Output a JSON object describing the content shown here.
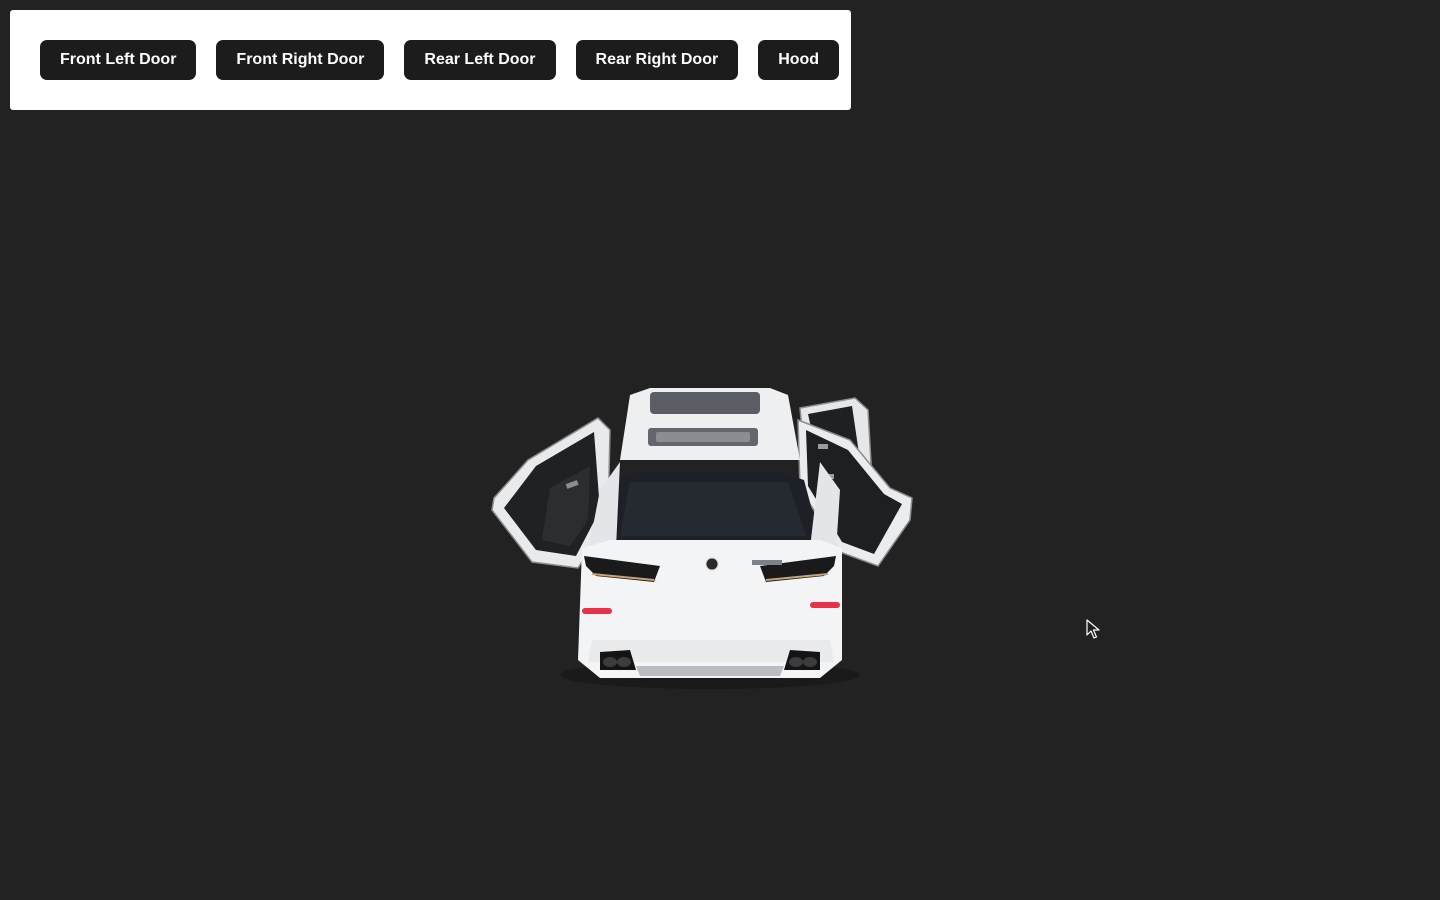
{
  "toolbar": {
    "buttons": [
      {
        "label": "Front Left Door"
      },
      {
        "label": "Front Right Door"
      },
      {
        "label": "Rear Left Door"
      },
      {
        "label": "Rear Right Door"
      },
      {
        "label": "Hood"
      }
    ]
  },
  "scene": {
    "model": "car-3d-model",
    "body_color": "#f2f3f5",
    "background_color": "#222223",
    "open_doors": [
      "Front Left Door",
      "Front Right Door",
      "Rear Right Door"
    ]
  },
  "cursor": {
    "icon": "pointer-cursor-icon"
  }
}
